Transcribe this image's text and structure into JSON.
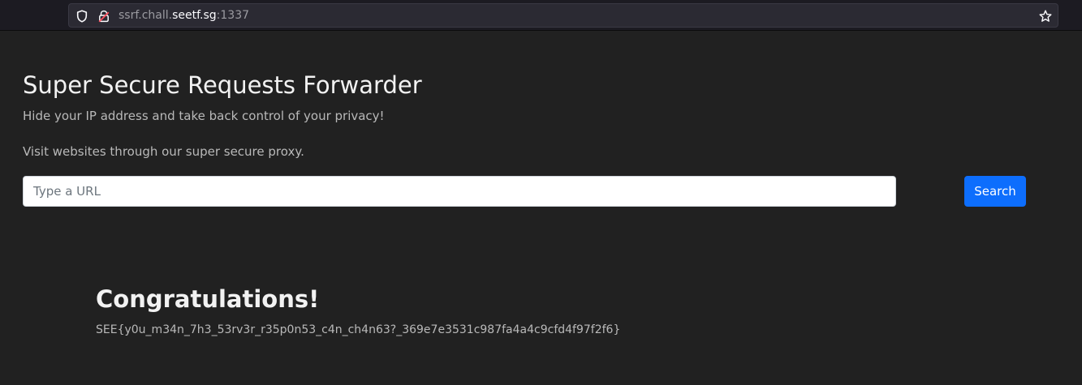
{
  "browser": {
    "url_prefix": "ssrf.chall.",
    "url_domain": "seetf.sg",
    "url_suffix": ":1337",
    "icons": {
      "shield": "shield-icon",
      "lock": "lock-icon",
      "bookmark": "star-icon"
    }
  },
  "page": {
    "title": "Super Secure Requests Forwarder",
    "subtitle": "Hide your IP address and take back control of your privacy!",
    "lead": "Visit websites through our super secure proxy.",
    "input_placeholder": "Type a URL",
    "search_label": "Search",
    "result_heading": "Congratulations!",
    "flag": "SEE{y0u_m34n_7h3_53rv3r_r35p0n53_c4n_ch4n63?_369e7e3531c987fa4a4c9cfd4f97f2f6}"
  },
  "colors": {
    "page_bg": "#212121",
    "toolbar_bg": "#1c1b22",
    "button_bg": "#0d6efd",
    "heading": "#f2f2f2",
    "muted_text": "#b9b9b9"
  }
}
